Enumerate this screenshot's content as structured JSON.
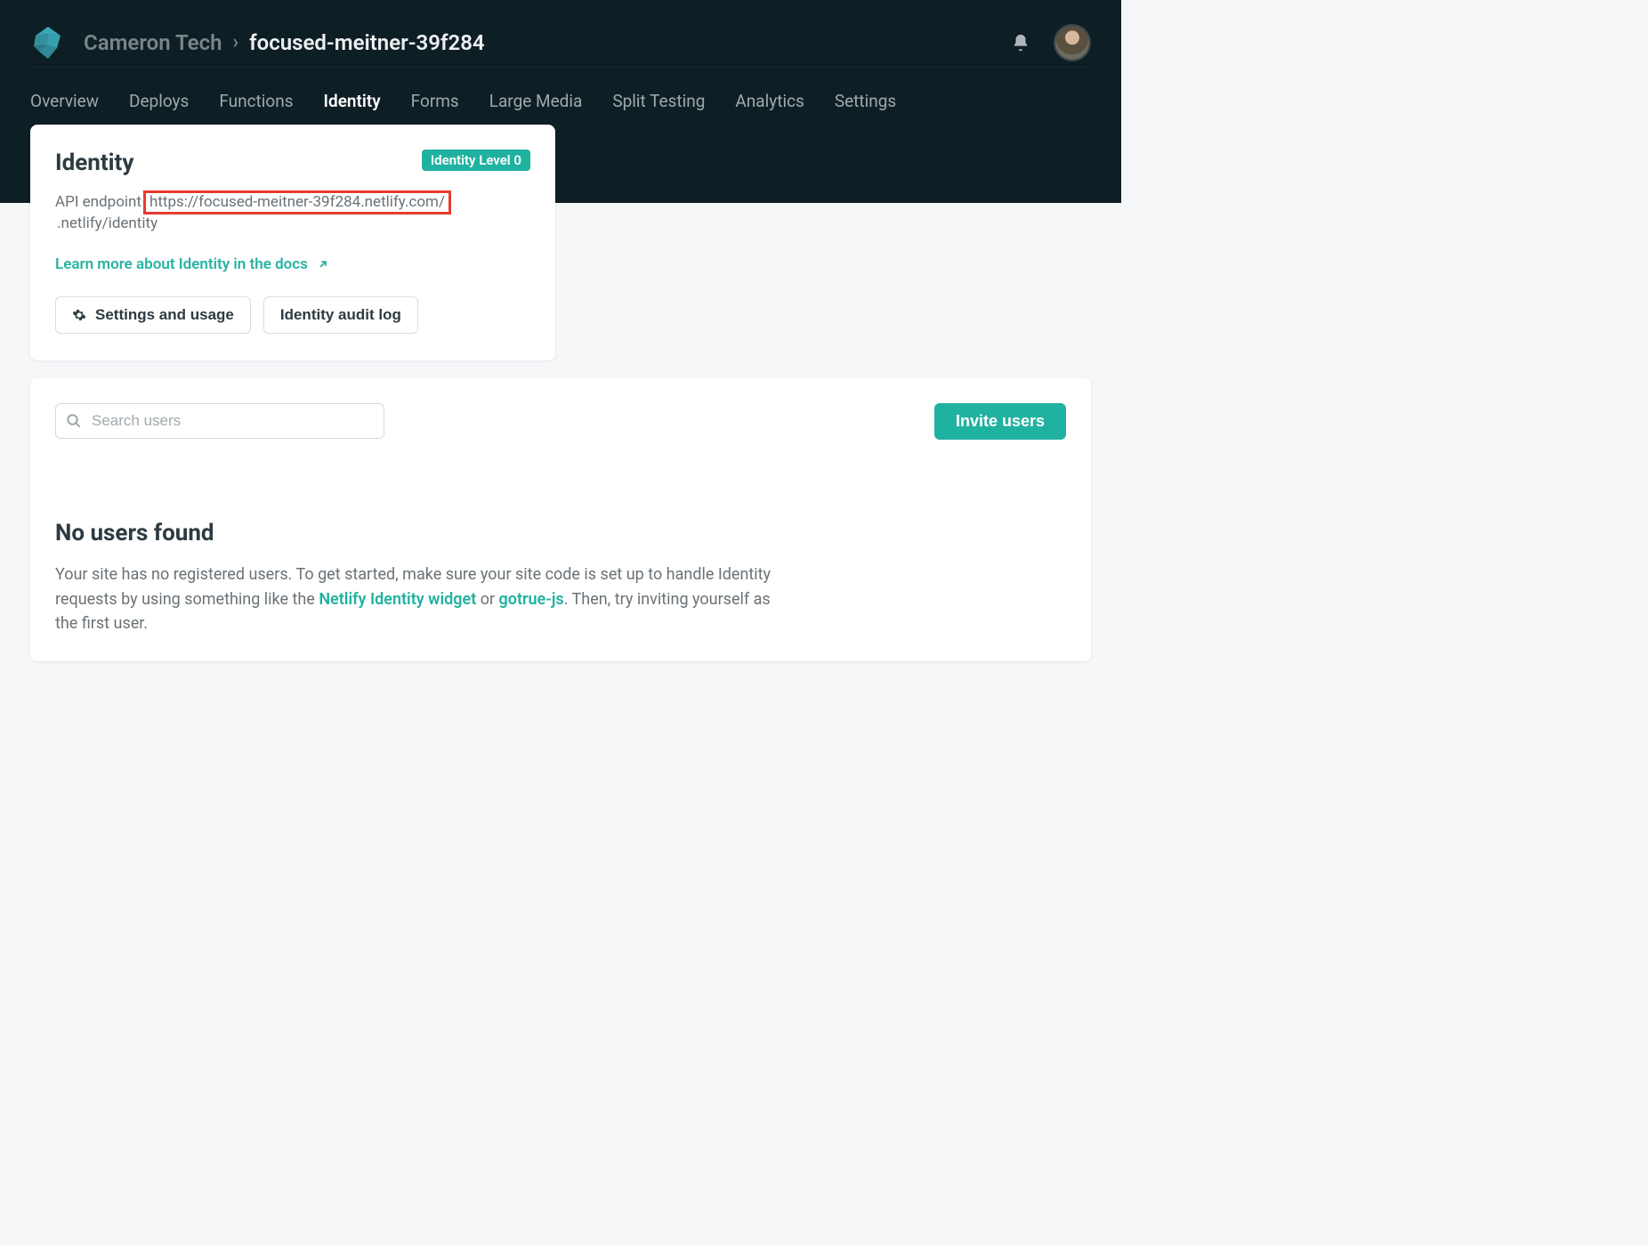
{
  "colors": {
    "accent": "#20b2a0",
    "highlight_border": "#e63c2f",
    "dark_bg": "#0e1e25"
  },
  "header": {
    "team_name": "Cameron Tech",
    "separator": "›",
    "site_name": "focused-meitner-39f284"
  },
  "tabs": [
    {
      "label": "Overview",
      "active": false
    },
    {
      "label": "Deploys",
      "active": false
    },
    {
      "label": "Functions",
      "active": false
    },
    {
      "label": "Identity",
      "active": true
    },
    {
      "label": "Forms",
      "active": false
    },
    {
      "label": "Large Media",
      "active": false
    },
    {
      "label": "Split Testing",
      "active": false
    },
    {
      "label": "Analytics",
      "active": false
    },
    {
      "label": "Settings",
      "active": false
    }
  ],
  "identity_card": {
    "title": "Identity",
    "level_badge": "Identity Level 0",
    "api_label": "API endpoint",
    "api_highlighted": "https://focused-meitner-39f284.netlify.com/",
    "api_suffix": ".netlify/identity",
    "docs_link_text": "Learn more about Identity in the docs",
    "settings_btn": "Settings and usage",
    "audit_btn": "Identity audit log"
  },
  "users_card": {
    "search_placeholder": "Search users",
    "invite_btn": "Invite users",
    "empty_title": "No users found",
    "empty_prefix": "Your site has no registered users. To get started, make sure your site code is set up to handle Identity requests by using something like the ",
    "empty_link1": "Netlify Identity widget",
    "empty_or": " or ",
    "empty_link2": "gotrue-js",
    "empty_suffix": ". Then, try inviting yourself as the first user."
  }
}
